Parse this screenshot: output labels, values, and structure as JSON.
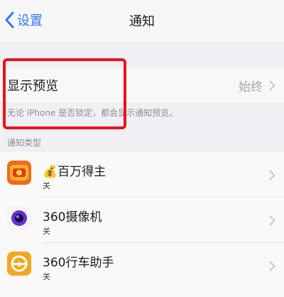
{
  "navbar": {
    "back_label": "设置",
    "title": "通知"
  },
  "preview": {
    "label": "显示预览",
    "value": "始终",
    "footer": "无论 iPhone 是否锁定，都会显示通知预览。"
  },
  "section_header": "通知类型",
  "apps": [
    {
      "name": "百万得主",
      "status": "关",
      "icon": "money-bag-icon"
    },
    {
      "name": "360摄像机",
      "status": "关",
      "icon": "camera-icon"
    },
    {
      "name": "360行车助手",
      "status": "关",
      "icon": "steering-wheel-icon"
    }
  ],
  "colors": {
    "accent": "#3478f6",
    "highlight": "#e8141a"
  }
}
